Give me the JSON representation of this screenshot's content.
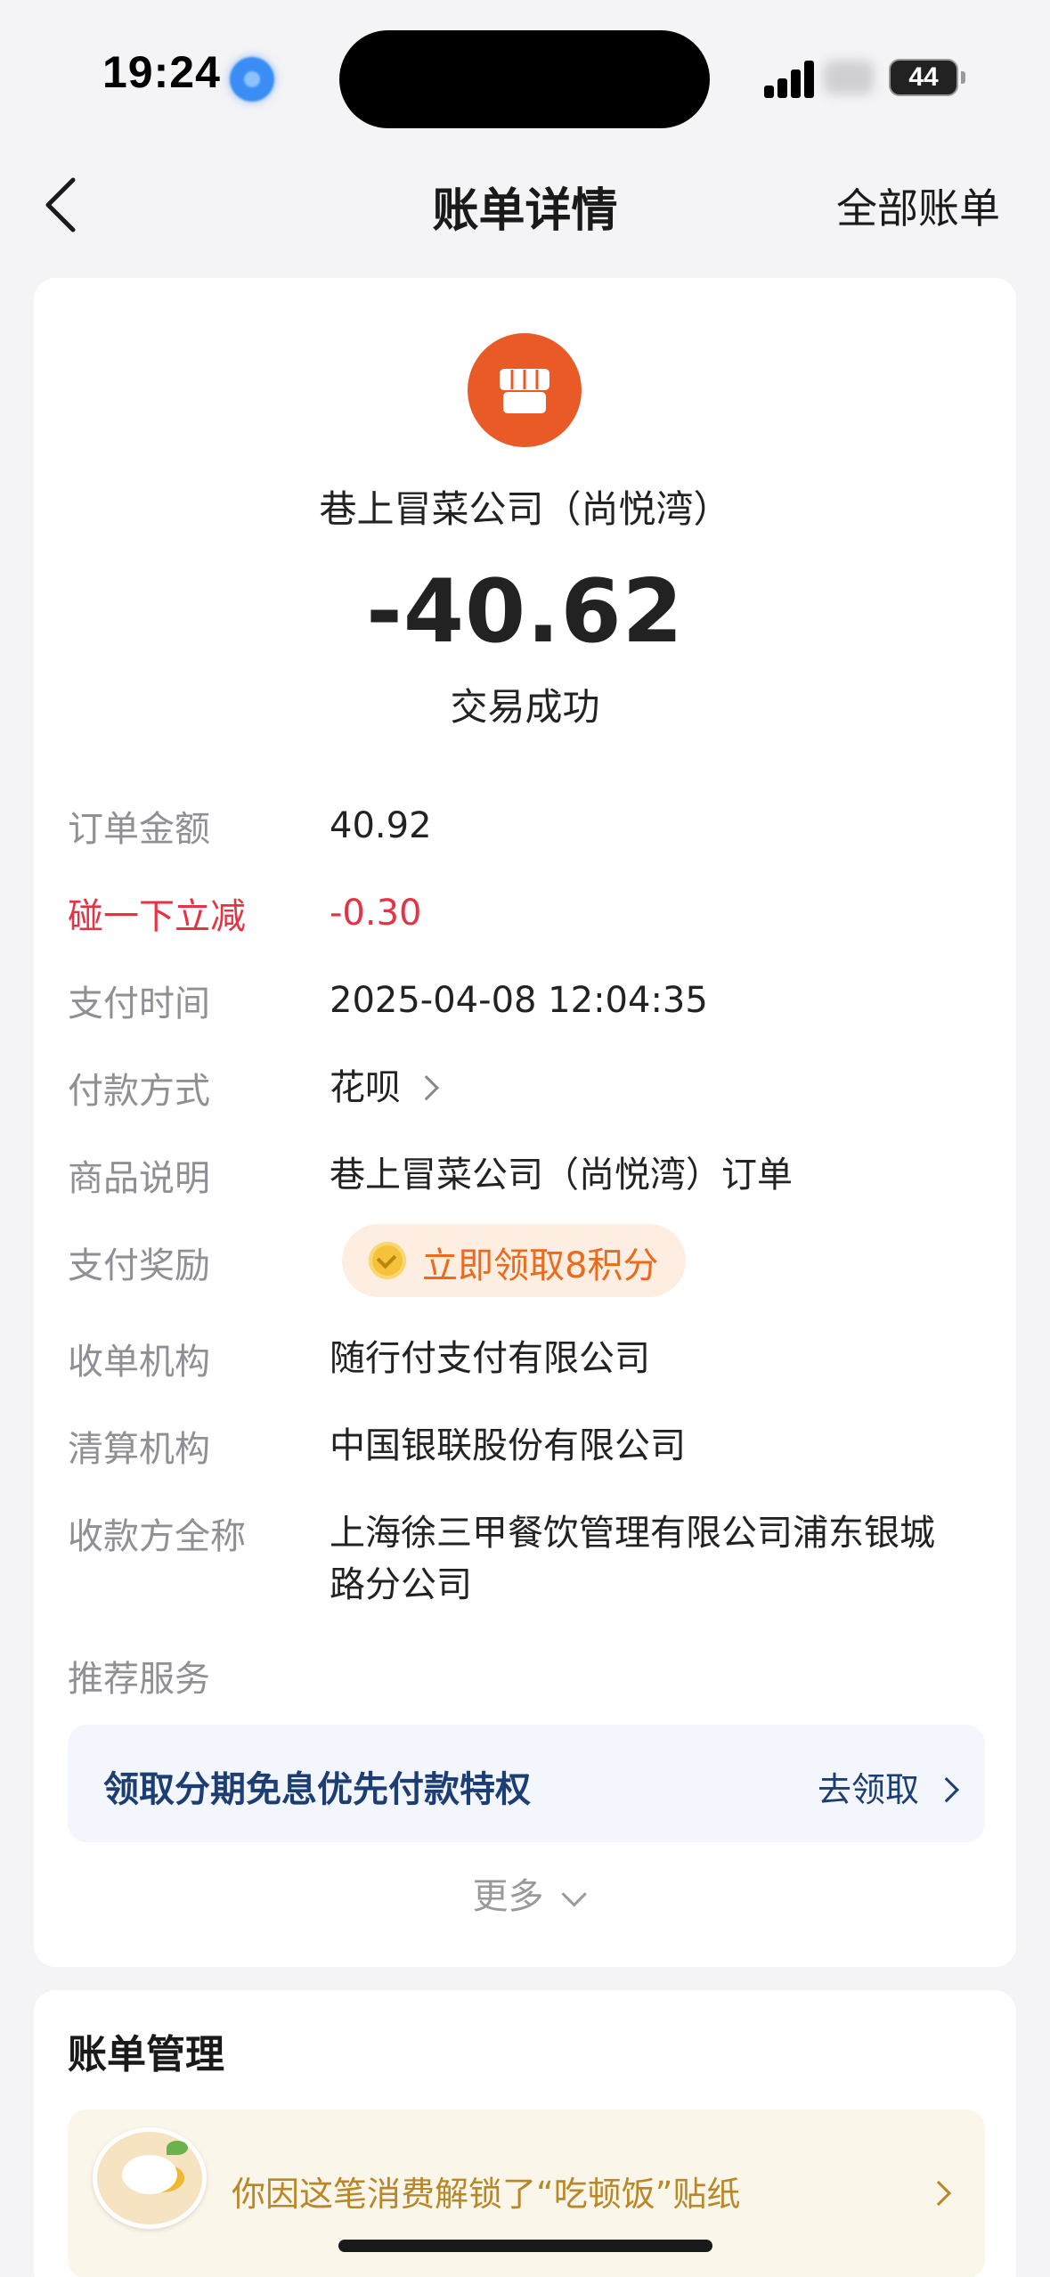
{
  "status_bar": {
    "time": "19:24",
    "battery": "44"
  },
  "nav": {
    "title": "账单详情",
    "right_link": "全部账单"
  },
  "bill": {
    "merchant": "巷上冒菜公司（尚悦湾）",
    "amount": "-40.62",
    "status": "交易成功"
  },
  "details": {
    "order_amount": {
      "label": "订单金额",
      "value": "40.92"
    },
    "discount": {
      "label": "碰一下立减",
      "value": "-0.30"
    },
    "pay_time": {
      "label": "支付时间",
      "value": "2025-04-08 12:04:35"
    },
    "pay_method": {
      "label": "付款方式",
      "value": "花呗"
    },
    "product_desc": {
      "label": "商品说明",
      "value": "巷上冒菜公司（尚悦湾）订单"
    },
    "reward": {
      "label": "支付奖励",
      "value": "立即领取8积分"
    },
    "acquirer": {
      "label": "收单机构",
      "value": "随行付支付有限公司"
    },
    "clearing": {
      "label": "清算机构",
      "value": "中国银联股份有限公司"
    },
    "payee": {
      "label": "收款方全称",
      "value": "上海徐三甲餐饮管理有限公司浦东银城路分公司"
    },
    "recommend": {
      "label": "推荐服务"
    }
  },
  "promo": {
    "title": "领取分期免息优先付款特权",
    "action": "去领取"
  },
  "more": "更多",
  "management": {
    "title": "账单管理",
    "sticker_text": "你因这笔消费解锁了“吃顿饭”贴纸"
  },
  "colors": {
    "merchant_logo": "#ea5a26",
    "discount_red": "#e63244",
    "reward_orange": "#ea6a1e",
    "promo_blue": "#1d3e72",
    "sticker_gold": "#b8872a"
  }
}
